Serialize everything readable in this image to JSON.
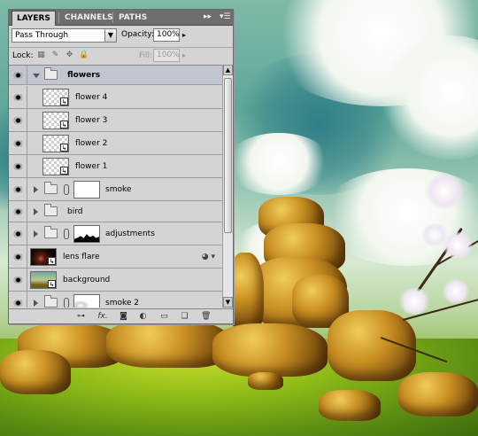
{
  "panel": {
    "tabs": [
      {
        "label": "LAYERS",
        "active": true
      },
      {
        "label": "CHANNELS",
        "active": false
      },
      {
        "label": "PATHS",
        "active": false
      }
    ],
    "collapse_icon": "double-arrow-right-icon",
    "menu_icon": "panel-menu-icon",
    "blend_mode": "Pass Through",
    "opacity_label": "Opacity:",
    "opacity_value": "100%",
    "lock_label": "Lock:",
    "lock_icons": [
      "lock-transparency-icon",
      "lock-image-icon",
      "lock-position-icon",
      "lock-all-icon"
    ],
    "fill_label": "Fill:",
    "fill_value": "100%",
    "layers": [
      {
        "name": "flowers",
        "kind": "group-open",
        "visible": true
      },
      {
        "name": "flower 4",
        "kind": "smart-object",
        "visible": true,
        "indent": 1
      },
      {
        "name": "flower 3",
        "kind": "smart-object",
        "visible": true,
        "indent": 1
      },
      {
        "name": "flower 2",
        "kind": "smart-object",
        "visible": true,
        "indent": 1
      },
      {
        "name": "flower 1",
        "kind": "smart-object",
        "visible": true,
        "indent": 1
      },
      {
        "name": "smoke",
        "kind": "group-masked",
        "visible": true
      },
      {
        "name": "bird",
        "kind": "group",
        "visible": true
      },
      {
        "name": "adjustments",
        "kind": "group-masked",
        "visible": true
      },
      {
        "name": "lens flare",
        "kind": "smart-object-fx",
        "visible": true
      },
      {
        "name": "background",
        "kind": "smart-object",
        "visible": true
      },
      {
        "name": "smoke 2",
        "kind": "group-masked",
        "visible": true
      }
    ],
    "bottom_icons": [
      "link-layers-icon",
      "fx-icon",
      "add-mask-icon",
      "adjustment-layer-icon",
      "new-group-icon",
      "new-layer-icon",
      "trash-icon"
    ],
    "fx_text": "fx."
  }
}
